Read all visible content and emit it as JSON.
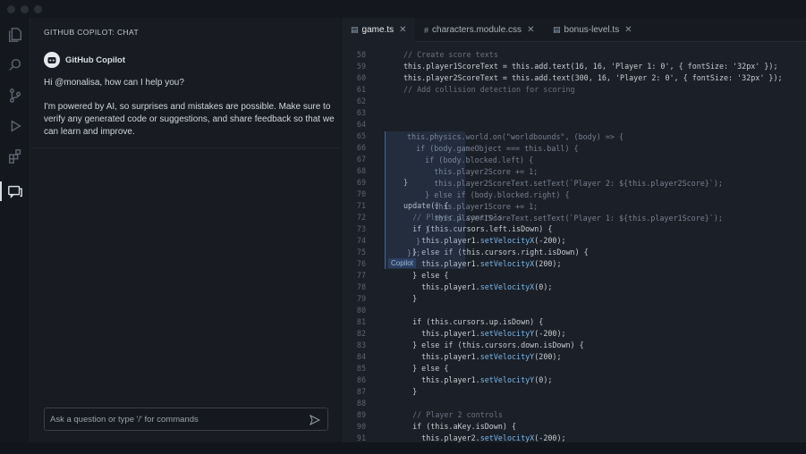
{
  "chat": {
    "header": "GITHUB COPILOT: CHAT",
    "bot_name": "GitHub Copilot",
    "greeting": "Hi @monalisa, how can I help you?",
    "disclaimer": "I'm powered by AI, so surprises and mistakes are possible. Make sure to verify any generated code or suggestions, and share feedback so that we can learn and improve.",
    "input_placeholder": "Ask a question or type '/' for commands"
  },
  "tabs": [
    {
      "label": "game.ts",
      "icon": "ts-file-icon",
      "active": true
    },
    {
      "label": "characters.module.css",
      "icon": "css-file-icon",
      "active": false
    },
    {
      "label": "bonus-level.ts",
      "icon": "ts-file-icon",
      "active": false
    }
  ],
  "code_lines": [
    {
      "n": "58",
      "text": "// Create score texts"
    },
    {
      "n": "59",
      "text": "this.player1ScoreText = this.add.text(16, 16, 'Player 1: 0', { fontSize: '32px' });"
    },
    {
      "n": "60",
      "text": "this.player2ScoreText = this.add.text(300, 16, 'Player 2: 0', { fontSize: '32px' });"
    },
    {
      "n": "61",
      "text": "// Add collision detection for scoring"
    },
    {
      "n": "62",
      "text": ""
    },
    {
      "n": "63",
      "text": ""
    },
    {
      "n": "64",
      "text": ""
    },
    {
      "n": "65",
      "text": ""
    },
    {
      "n": "66",
      "text": ""
    },
    {
      "n": "67",
      "text": ""
    },
    {
      "n": "68",
      "text": ""
    },
    {
      "n": "69",
      "text": "}"
    },
    {
      "n": "70",
      "text": ""
    },
    {
      "n": "71",
      "text": "update() {"
    },
    {
      "n": "72",
      "text": "  // Player 1 controls"
    },
    {
      "n": "73",
      "text": "  if (this.cursors.left.isDown) {"
    },
    {
      "n": "74",
      "text": "    this.player1.setVelocityX(-200);"
    },
    {
      "n": "75",
      "text": "  } else if (this.cursors.right.isDown) {"
    },
    {
      "n": "76",
      "text": "    this.player1.setVelocityX(200);"
    },
    {
      "n": "77",
      "text": "  } else {"
    },
    {
      "n": "78",
      "text": "    this.player1.setVelocityX(0);"
    },
    {
      "n": "79",
      "text": "  }"
    },
    {
      "n": "80",
      "text": ""
    },
    {
      "n": "81",
      "text": "  if (this.cursors.up.isDown) {"
    },
    {
      "n": "82",
      "text": "    this.player1.setVelocityY(-200);"
    },
    {
      "n": "83",
      "text": "  } else if (this.cursors.down.isDown) {"
    },
    {
      "n": "84",
      "text": "    this.player1.setVelocityY(200);"
    },
    {
      "n": "85",
      "text": "  } else {"
    },
    {
      "n": "86",
      "text": "    this.player1.setVelocityY(0);"
    },
    {
      "n": "87",
      "text": "  }"
    },
    {
      "n": "88",
      "text": ""
    },
    {
      "n": "89",
      "text": "  // Player 2 controls"
    },
    {
      "n": "90",
      "text": "  if (this.aKey.isDown) {"
    },
    {
      "n": "91",
      "text": "    this.player2.setVelocityX(-200);"
    }
  ],
  "suggestion_lines": [
    "this.physics.world.on(\"worldbounds\", (body) => {",
    "  if (body.gameObject === this.ball) {",
    "    if (body.blocked.left) {",
    "      this.player2Score += 1;",
    "      this.player2ScoreText.setText(`Player 2: ${this.player2Score}`);",
    "    } else if (body.blocked.right) {",
    "      this.player1Score += 1;",
    "      this.player1ScoreText.setText(`Player 1: ${this.player1Score}`);",
    "    }",
    "  }",
    "});"
  ],
  "suggestion_badge": "Copilot"
}
